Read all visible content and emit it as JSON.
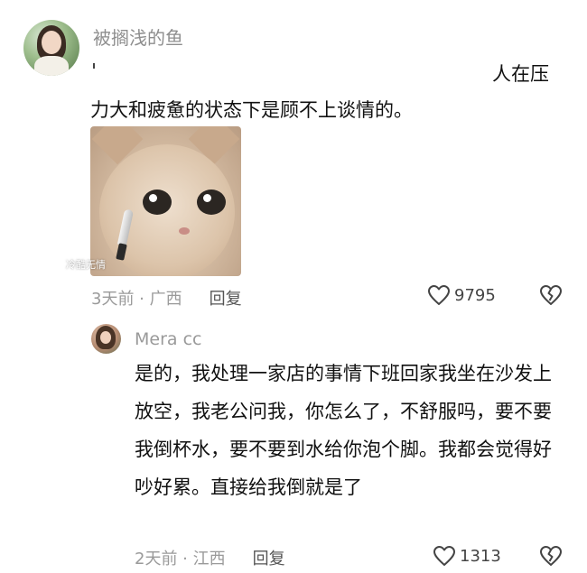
{
  "comment": {
    "username": "被搁浅的鱼",
    "text_line1": "人在压",
    "text_line2": "力大和疲惫的状态下是顾不上谈情的。",
    "image_caption": "冷酷无情",
    "time_location": "3天前 · 广西",
    "reply_label": "回复",
    "like_count": "9795"
  },
  "reply": {
    "username": "Mera cc",
    "text": "是的，我处理一家店的事情下班回家我坐在沙发上放空，我老公问我，你怎么了，不舒服吗，要不要我倒杯水，要不要到水给你泡个脚。我都会觉得好吵好累。直接给我倒就是了",
    "time_location": "2天前 · 江西",
    "reply_label": "回复",
    "like_count": "1313"
  },
  "icons": {
    "like": "heart-outline-icon",
    "dislike": "broken-heart-icon"
  },
  "colors": {
    "text_primary": "#111111",
    "text_secondary": "#9a9a9a",
    "icon": "#444444"
  }
}
